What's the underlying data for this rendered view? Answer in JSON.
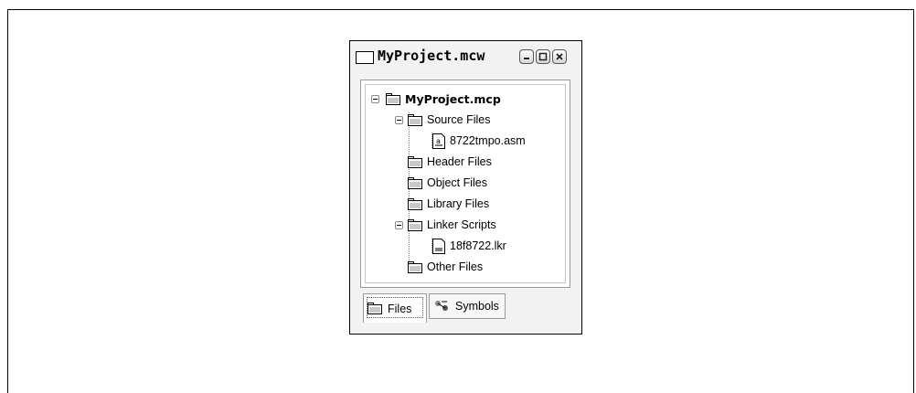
{
  "window": {
    "title": "MyProject.mcw",
    "controls": [
      "minimize-icon",
      "maximize-icon",
      "close-icon"
    ]
  },
  "tree": {
    "root": "MyProject.mcp",
    "items": [
      {
        "label": "Source Files",
        "type": "folder",
        "expanded": true
      },
      {
        "label": "8722tmpo.asm",
        "type": "asm-file"
      },
      {
        "label": "Header Files",
        "type": "folder"
      },
      {
        "label": "Object Files",
        "type": "folder"
      },
      {
        "label": "Library Files",
        "type": "folder"
      },
      {
        "label": "Linker Scripts",
        "type": "folder",
        "expanded": true
      },
      {
        "label": "18f8722.lkr",
        "type": "file"
      },
      {
        "label": "Other Files",
        "type": "folder"
      }
    ]
  },
  "tabs": {
    "files": "Files",
    "symbols": "Symbols",
    "active": "Files"
  }
}
